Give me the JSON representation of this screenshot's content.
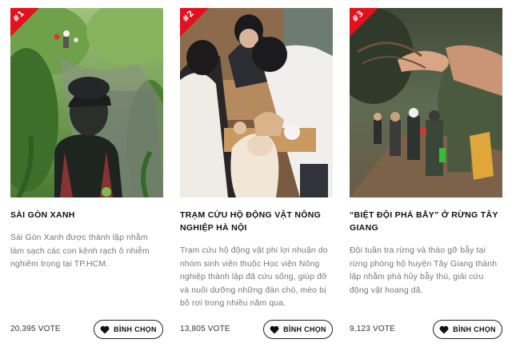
{
  "cards": [
    {
      "rank": "#1",
      "title": "SÀI GÒN XANH",
      "description": "Sài Gòn Xanh được thành lập nhằm làm sạch các con kênh rạch ô nhiễm nghiêm trọng tại TP.HCM.",
      "votes": "20,395 VOTE",
      "button_label": "BÌNH CHỌN",
      "button_icon": "heart-icon"
    },
    {
      "rank": "#2",
      "title": "TRẠM CỨU HỘ ĐỘNG VẬT NÔNG NGHIỆP HÀ NỘI",
      "description": "Trạm cứu hộ động vật phi lợi nhuận do nhóm sinh viên thuộc Học viện Nông nghiệp thành lập đã cứu sống, giúp đỡ và nuôi dưỡng những đàn chó, mèo bị bỏ rơi trong nhiều năm qua.",
      "votes": "13,805 VOTE",
      "button_label": "BÌNH CHỌN",
      "button_icon": "heart-icon"
    },
    {
      "rank": "#3",
      "title": "“BIỆT ĐỘI PHÁ BẪY” Ở RỪNG TÂY GIANG",
      "description": "Đội tuần tra rừng và tháo gỡ bẫy tại rừng phòng hộ huyện Tây Giang thành lập nhằm phá hủy bẫy thú, giải cứu động vật hoang dã.",
      "votes": "9,123 VOTE",
      "button_label": "BÌNH CHỌN",
      "button_icon": "heart-icon"
    }
  ],
  "colors": {
    "rank_badge": "#e5101e",
    "button_border": "#222222",
    "description_text": "#777777"
  }
}
